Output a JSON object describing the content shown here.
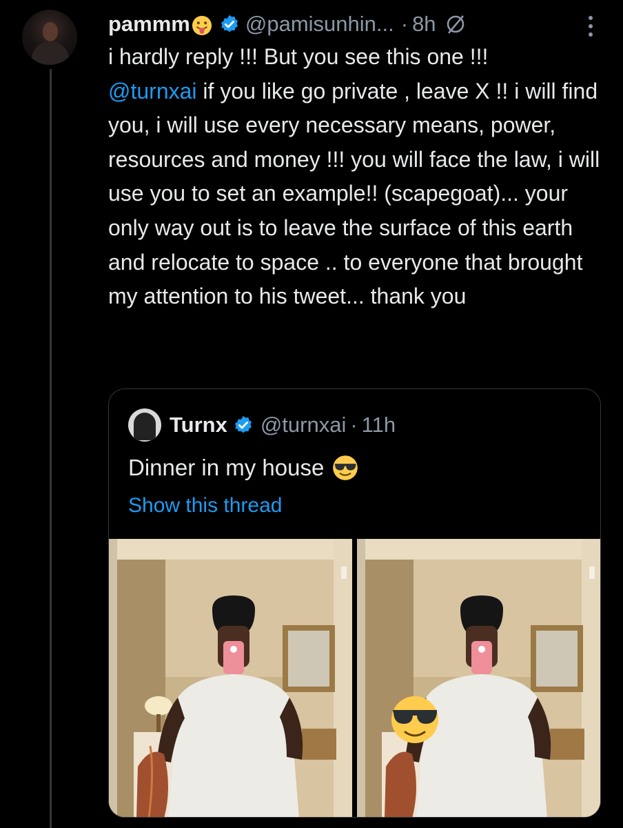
{
  "tweet": {
    "display_name": "pammm",
    "name_emoji_icon": "tongue-out-face-icon",
    "handle": "@pamisunhin...",
    "separator": "·",
    "time": "8h",
    "verified_icon": "verified-badge-icon",
    "status_icon": "empty-set-icon",
    "more_icon": "more-vertical-icon",
    "text_before": "i hardly reply !!! But you see this one !!!",
    "mention": "@turnxai",
    "text_after": " if you like go private , leave X !! i will find you, i will use every necessary means, power, resources and money !!! you will face the law, i will use you to set an example!! (scapegoat)... your only way out is to leave the surface of this earth and relocate to space .. to everyone that brought my attention to his tweet... thank you"
  },
  "quote": {
    "display_name": "Turnx",
    "handle": "@turnxai",
    "separator": "·",
    "time": "11h",
    "text": "Dinner in my house",
    "text_emoji_icon": "sunglasses-face-icon",
    "show_thread": "Show this thread",
    "photos": [
      "mirror-selfie-photo-1",
      "mirror-selfie-photo-2"
    ]
  },
  "colors": {
    "background": "#000000",
    "text": "#e7e9ea",
    "secondary": "#8b98a5",
    "link": "#1d9bf0",
    "border": "#333639"
  }
}
